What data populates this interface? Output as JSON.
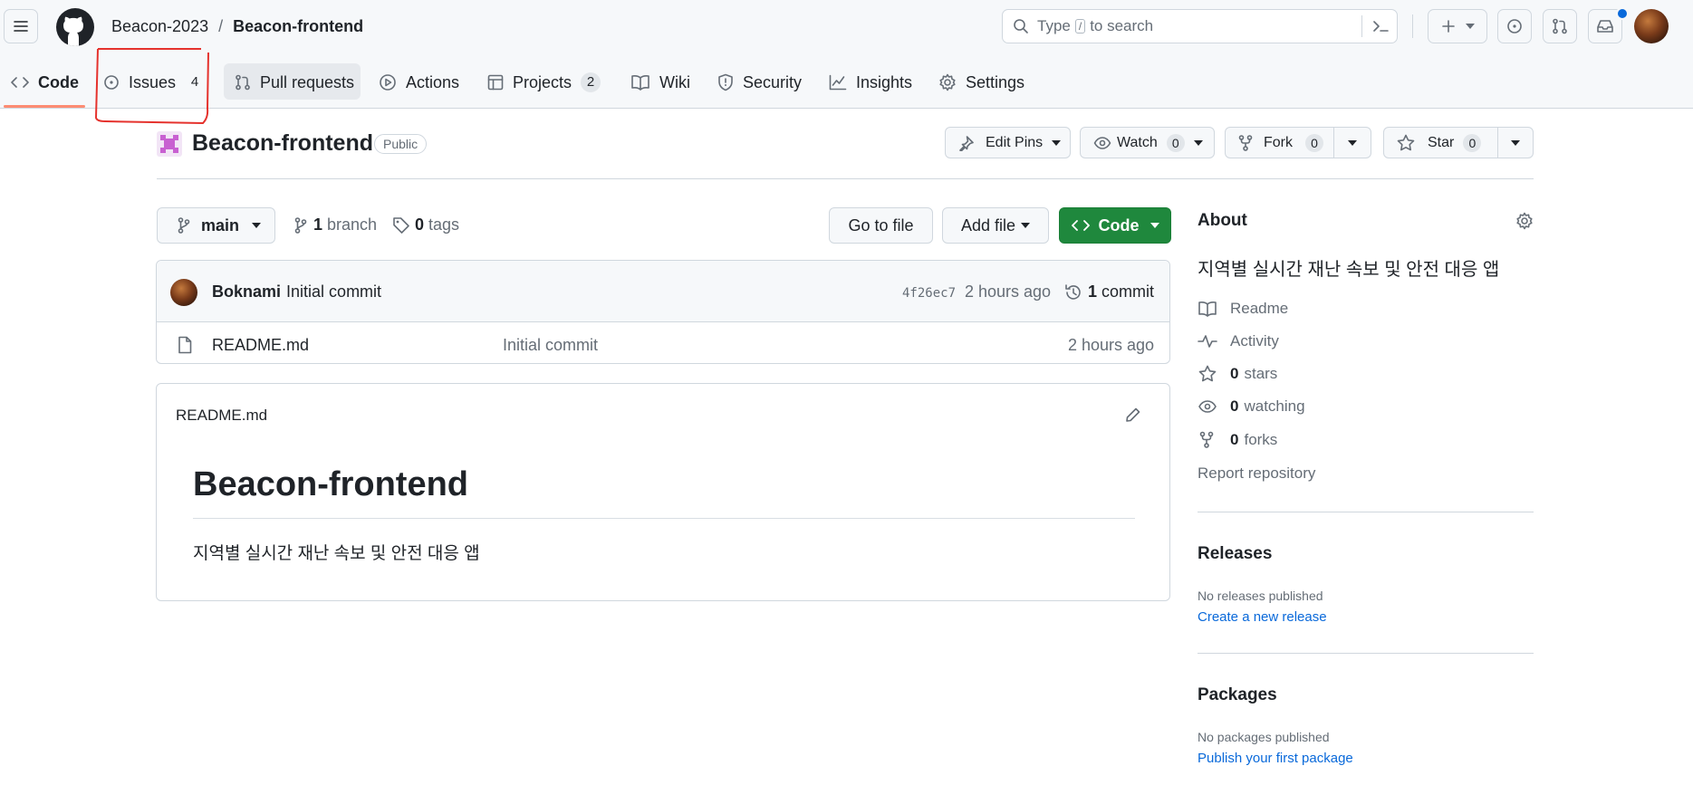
{
  "header": {
    "owner": "Beacon-2023",
    "separator": "/",
    "repo": "Beacon-frontend",
    "search_placeholder_pre": "Type",
    "search_key": "/",
    "search_placeholder_post": "to search"
  },
  "tabs": [
    {
      "label": "Code",
      "icon": "code-icon"
    },
    {
      "label": "Issues",
      "count": "4",
      "icon": "issue-icon"
    },
    {
      "label": "Pull requests",
      "icon": "pull-request-icon"
    },
    {
      "label": "Actions",
      "icon": "play-icon"
    },
    {
      "label": "Projects",
      "count": "2",
      "icon": "table-icon"
    },
    {
      "label": "Wiki",
      "icon": "book-icon"
    },
    {
      "label": "Security",
      "icon": "shield-icon"
    },
    {
      "label": "Insights",
      "icon": "graph-icon"
    },
    {
      "label": "Settings",
      "icon": "gear-icon"
    }
  ],
  "repo_header": {
    "name": "Beacon-frontend",
    "visibility": "Public",
    "edit_pins": "Edit Pins",
    "watch": "Watch",
    "watch_count": "0",
    "fork": "Fork",
    "fork_count": "0",
    "star": "Star",
    "star_count": "0"
  },
  "toolbar": {
    "branch": "main",
    "branch_count": "1",
    "branch_label": "branch",
    "tag_count": "0",
    "tag_label": "tags",
    "go_to_file": "Go to file",
    "add_file": "Add file",
    "code": "Code"
  },
  "commit": {
    "author": "Boknami",
    "message": "Initial commit",
    "hash": "4f26ec7",
    "time": "2 hours ago",
    "count": "1",
    "count_label": "commit"
  },
  "files": [
    {
      "name": "README.md",
      "message": "Initial commit",
      "time": "2 hours ago"
    }
  ],
  "readme": {
    "filename": "README.md",
    "heading": "Beacon-frontend",
    "body": "지역별 실시간 재난 속보 및 안전 대응 앱"
  },
  "about": {
    "title": "About",
    "description": "지역별 실시간 재난 속보 및 안전 대응 앱",
    "readme": "Readme",
    "activity": "Activity",
    "stars_count": "0",
    "stars_label": "stars",
    "watching_count": "0",
    "watching_label": "watching",
    "forks_count": "0",
    "forks_label": "forks",
    "report": "Report repository"
  },
  "releases": {
    "title": "Releases",
    "empty": "No releases published",
    "create": "Create a new release"
  },
  "packages": {
    "title": "Packages",
    "empty": "No packages published",
    "publish": "Publish your first package"
  },
  "colors": {
    "accent": "#0969da",
    "code_button": "#1f883d",
    "annotation": "#e5322d"
  }
}
